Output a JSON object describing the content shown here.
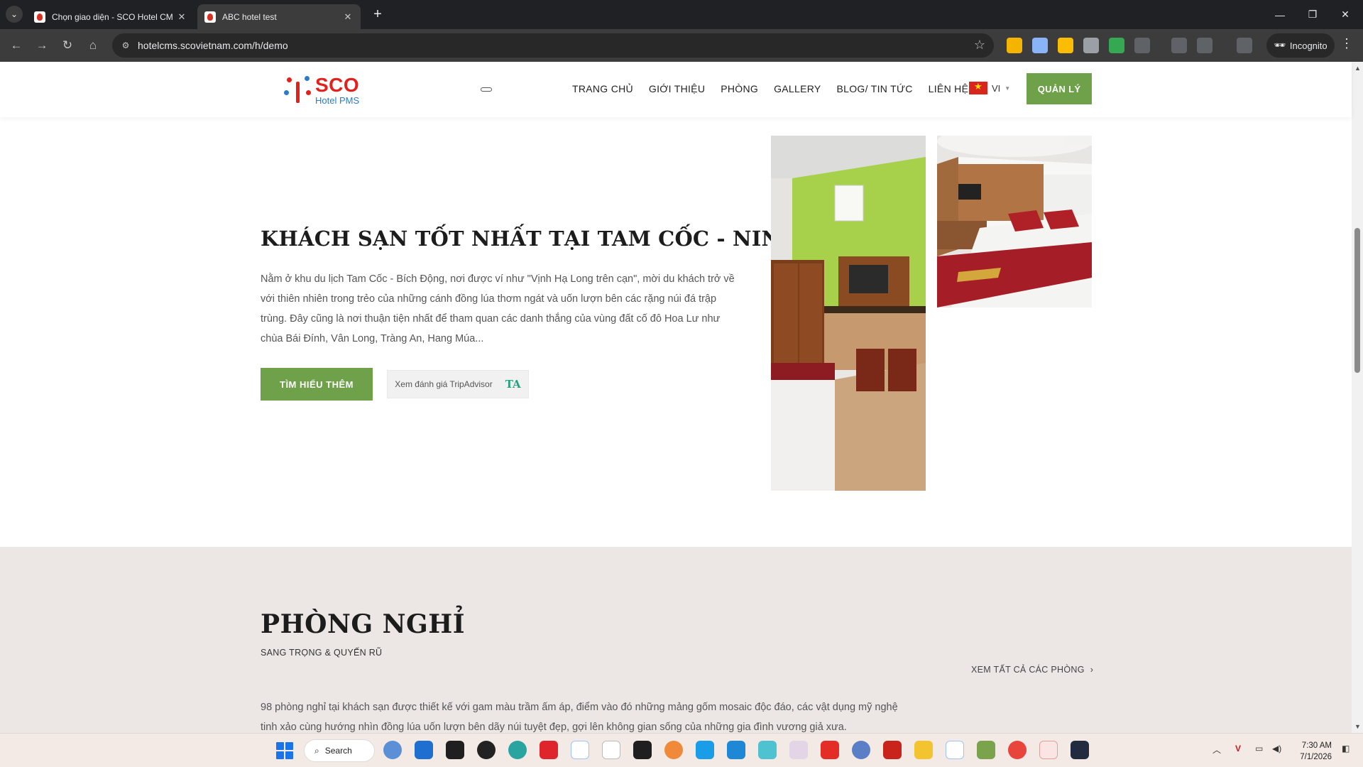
{
  "browser": {
    "tabs": [
      {
        "title": "Chọn giao diện - SCO Hotel CM",
        "active": false
      },
      {
        "title": "ABC hotel test",
        "active": true
      }
    ],
    "url": "hotelcms.scovietnam.com/h/demo",
    "incognito_label": "Incognito",
    "icons": {
      "tab_search": "chevron-down-icon",
      "new_tab": "plus-icon",
      "back": "arrow-left-icon",
      "forward": "arrow-right-icon",
      "reload": "reload-icon",
      "home": "home-icon",
      "bookmark": "star-icon"
    }
  },
  "header": {
    "logo_text": "SCO",
    "logo_subtext": "Hotel PMS",
    "menu": [
      "TRANG CHỦ",
      "GIỚI THIỆU",
      "PHÒNG",
      "GALLERY",
      "BLOG/ TIN TỨC",
      "LIÊN HỆ"
    ],
    "language": "VI",
    "manage_button": "QUẢN LÝ",
    "accent_color": "#6ea14a",
    "brand_color": "#e2211c"
  },
  "intro": {
    "title": "KHÁCH SẠN TỐT NHẤT TẠI TAM CỐC - NINH BÌNH",
    "text": "Nằm ở khu du lịch Tam Cốc - Bích Động, nơi được ví như \"Vịnh Hạ Long trên cạn\", mời du khách trở về với thiên nhiên trong trẻo của những cánh đồng lúa thơm ngát và uốn lượn bên các rặng núi đá trập trùng. Đây cũng là nơi thuận tiện nhất để tham quan các danh thắng của vùng đất cố đô Hoa Lư như chùa Bái Đính, Vân Long, Tràng An, Hang Múa...",
    "learn_more_button": "TÌM HIỂU THÊM",
    "tripadvisor_button": "Xem đánh giá TripAdvisor",
    "tripadvisor_icon_text": "TA"
  },
  "rooms": {
    "title": "PHÒNG NGHỈ",
    "subtitle": "SANG TRỌNG & QUYẾN RŨ",
    "view_all_link": "XEM TẤT CẢ CÁC PHÒNG",
    "text": "98 phòng nghỉ tại khách sạn được thiết kế với gam màu trầm ấm áp, điểm vào đó những mảng gốm mosaic độc đáo, các vật dụng mỹ nghệ tinh xảo cùng hướng nhìn đồng lúa uốn lượn bên dãy núi tuyệt đẹp, gợi lên không gian sống của những gia đình vương giả xưa."
  },
  "taskbar": {
    "search_label": "Search",
    "time": "7:30 AM",
    "date": "7/1/2026"
  }
}
